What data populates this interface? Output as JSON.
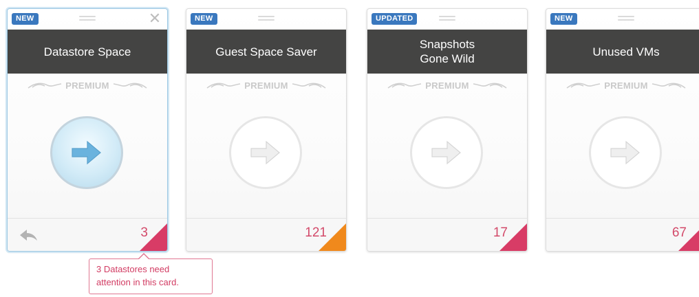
{
  "colors": {
    "badge_blue": "#3a78be",
    "title_bar": "#444443",
    "count_text": "#d34a6a",
    "corner_pink": "#d83c66",
    "corner_orange": "#f0891c",
    "active_border": "#9cc8e3"
  },
  "cards": [
    {
      "badge": "NEW",
      "title": "Datastore Space",
      "premium": "PREMIUM",
      "count": "3",
      "corner_color": "#d83c66",
      "active": true,
      "icon": "arrow-right-icon"
    },
    {
      "badge": "NEW",
      "title": "Guest Space Saver",
      "premium": "PREMIUM",
      "count": "121",
      "corner_color": "#f0891c",
      "active": false,
      "icon": "arrow-right-icon"
    },
    {
      "badge": "UPDATED",
      "title": "Snapshots\nGone Wild",
      "premium": "PREMIUM",
      "count": "17",
      "corner_color": "#d83c66",
      "active": false,
      "icon": "arrow-right-icon"
    },
    {
      "badge": "NEW",
      "title": "Unused VMs",
      "premium": "PREMIUM",
      "count": "67",
      "corner_color": "#d83c66",
      "active": false,
      "icon": "arrow-right-icon"
    }
  ],
  "callout": {
    "line1": "3 Datastores need",
    "line2": "attention in this card."
  }
}
